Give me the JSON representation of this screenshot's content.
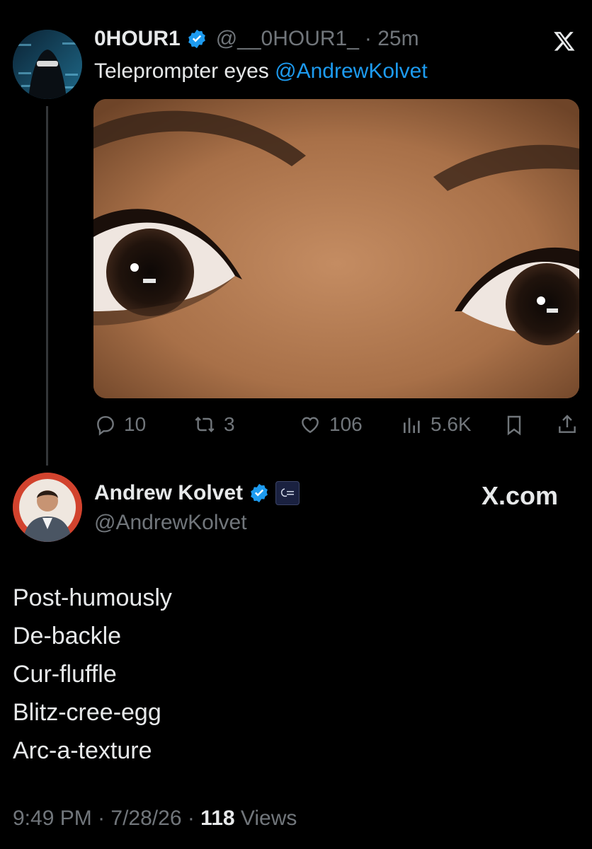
{
  "parent_tweet": {
    "display_name": "0HOUR1",
    "handle": "@__0HOUR1_",
    "time": "· 25m",
    "text": "Teleprompter eyes",
    "mention": "@AndrewKolvet",
    "actions": {
      "replies": "10",
      "reposts": "3",
      "likes": "106",
      "views": "5.6K"
    }
  },
  "main_tweet": {
    "display_name": "Andrew Kolvet",
    "handle": "@AndrewKolvet",
    "watermark": "X.com",
    "lines": [
      "Post-humously",
      "De-backle",
      "Cur-fluffle",
      "Blitz-cree-egg",
      "Arc-a-texture"
    ],
    "time": "9:49 PM",
    "date": "7/28/26",
    "views_count": "118",
    "views_label": "Views"
  },
  "colors": {
    "background": "#000000",
    "text": "#e7e9ea",
    "muted": "#71767b",
    "link": "#1d9bf0",
    "verified": "#1d9bf0"
  },
  "icons": [
    "x-logo-icon",
    "verified-badge-icon",
    "reply-icon",
    "repost-icon",
    "like-icon",
    "views-icon",
    "bookmark-icon",
    "share-icon",
    "affiliate-badge-icon"
  ]
}
